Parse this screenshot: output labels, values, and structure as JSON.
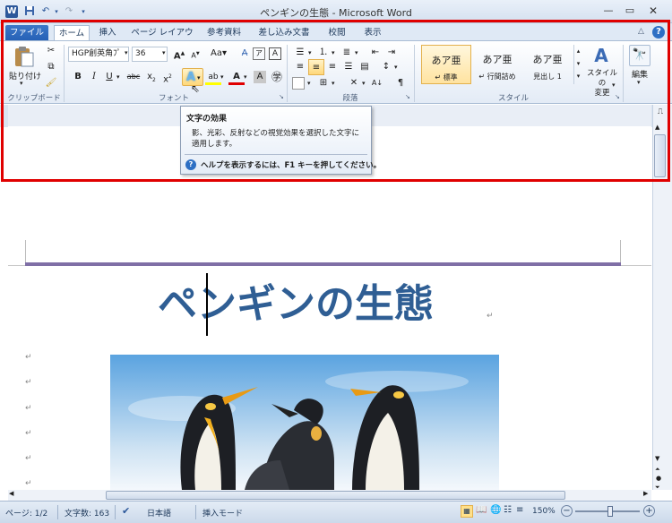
{
  "window": {
    "title": "ペンギンの生態 - Microsoft Word"
  },
  "tabs": [
    {
      "label": "ファイル"
    },
    {
      "label": "ホーム"
    },
    {
      "label": "挿入"
    },
    {
      "label": "ページ レイアウト"
    },
    {
      "label": "参考資料"
    },
    {
      "label": "差し込み文書"
    },
    {
      "label": "校閲"
    },
    {
      "label": "表示"
    }
  ],
  "ribbon": {
    "clipboard": {
      "paste_label": "貼り付け",
      "group_label": "クリップボード"
    },
    "font": {
      "font_name": "HGP創英角ﾌﾟ",
      "font_size": "36",
      "group_label": "フォント"
    },
    "paragraph": {
      "group_label": "段落"
    },
    "styles": {
      "group_label": "スタイル",
      "items": [
        {
          "preview": "あア亜",
          "label": "↵ 標準"
        },
        {
          "preview": "あア亜",
          "label": "↵ 行間詰め"
        },
        {
          "preview": "あア亜",
          "label": "見出し 1"
        }
      ],
      "change_label": "スタイルの",
      "change_label2": "変更"
    },
    "editing": {
      "label": "編集"
    }
  },
  "tooltip": {
    "title": "文字の効果",
    "body": "影、光彩、反射などの視覚効果を選択した文字に適用します。",
    "help": "ヘルプを表示するには、F1 キーを押してください。"
  },
  "document": {
    "heading": "ペンギンの生態",
    "paragraph_mark": "↵"
  },
  "statusbar": {
    "page": "ページ: 1/2",
    "words": "文字数: 163",
    "language": "日本語",
    "mode": "挿入モード",
    "zoom": "150%"
  },
  "colors": {
    "highlight": "#e00000",
    "file_tab": "#2b65b7",
    "title_text": "#2f5e94",
    "title_line": "#7f6fa6"
  }
}
